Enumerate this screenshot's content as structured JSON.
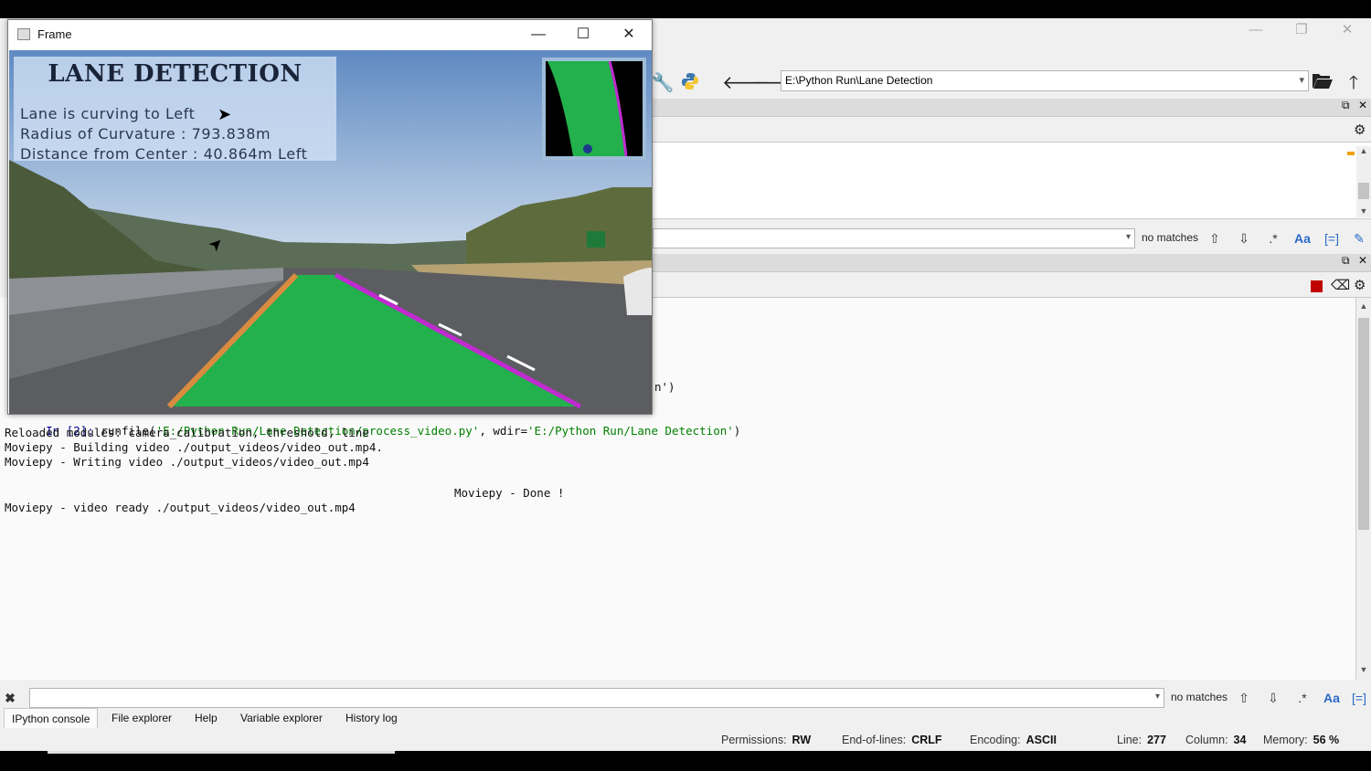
{
  "ide": {
    "window_controls": {
      "minimize": "—",
      "restore": "❐",
      "close": "✕"
    },
    "toolbar": {
      "path_value": "E:\\Python Run\\Lane Detection",
      "icons": [
        "wrench-icon",
        "python-icon",
        "back-arrow-icon",
        "forward-arrow-icon",
        "folder-open-icon",
        "up-arrow-icon"
      ]
    },
    "editor_find": {
      "no_matches": "no matches"
    },
    "console": {
      "partial_line_fragment": "n')",
      "lines": [
        {
          "prompt": "In [2]: ",
          "code_start": "runfile(",
          "str1": "'E:/Python Run/Lane Detection/process_video.py'",
          "mid": ", wdir=",
          "str2": "'E:/Python Run/Lane Detection'",
          "end": ")"
        },
        {
          "text": "Reloaded modules: camera_calibration, threshold, line"
        },
        {
          "text": "Moviepy - Building video ./output_videos/video_out.mp4."
        },
        {
          "text": "Moviepy - Writing video ./output_videos/video_out.mp4"
        },
        {
          "text": "Moviepy - Done !"
        },
        {
          "text": "Moviepy - video ready ./output_videos/video_out.mp4"
        }
      ]
    },
    "console_find": {
      "no_matches": "no matches"
    },
    "tabs": [
      "IPython console",
      "File explorer",
      "Help",
      "Variable explorer",
      "History log"
    ],
    "active_tab": "IPython console",
    "status": {
      "permissions_label": "Permissions:",
      "permissions_value": "RW",
      "eol_label": "End-of-lines:",
      "eol_value": "CRLF",
      "encoding_label": "Encoding:",
      "encoding_value": "ASCII",
      "line_label": "Line:",
      "line_value": "277",
      "column_label": "Column:",
      "column_value": "34",
      "memory_label": "Memory:",
      "memory_value": "56 %"
    }
  },
  "frame_window": {
    "title": "Frame",
    "controls": {
      "minimize": "—",
      "maximize": "☐",
      "close": "✕"
    },
    "hud": {
      "title": "LANE DETECTION",
      "line1": "Lane is curving to Left",
      "line2": "Radius of Curvature : 793.838m",
      "line3": "Distance from Center : 40.864m Left"
    },
    "colors": {
      "lane_fill": "#22b14c",
      "lane_edge": "#c02bd0",
      "sky": "#6f96c8"
    }
  }
}
